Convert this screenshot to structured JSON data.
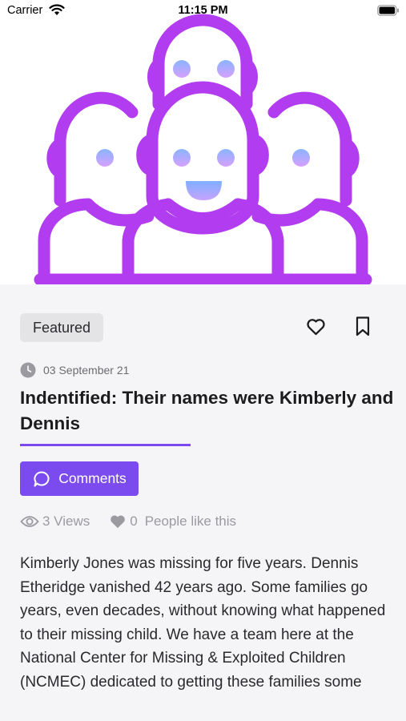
{
  "status_bar": {
    "carrier": "Carrier",
    "time": "11:15 PM"
  },
  "article": {
    "tag": "Featured",
    "date": "03 September 21",
    "title": "Indentified: Their names were Kimberly and Dennis",
    "comments_button": "Comments",
    "views": "3 Views",
    "likes_count": "0",
    "likes_label": "People like this",
    "body": "Kimberly Jones was missing for five years. Dennis Etheridge vanished 42 years ago. Some families go years, even decades, without knowing what happened to their missing child. We have a team here at the National Center for Missing & Exploited Children (NCMEC) dedicated to getting these families some"
  },
  "icons": {
    "wifi": "wifi-icon",
    "battery": "battery-icon",
    "heart": "heart-icon",
    "bookmark": "bookmark-icon",
    "clock": "clock-icon",
    "comment": "comment-bubble-icon",
    "eye": "eye-icon",
    "heart_small": "heart-filled-icon"
  },
  "colors": {
    "accent": "#7b4bf0",
    "gradient_top": "#3d6df5",
    "gradient_bottom": "#b23df0",
    "background": "#f5f5f7"
  }
}
